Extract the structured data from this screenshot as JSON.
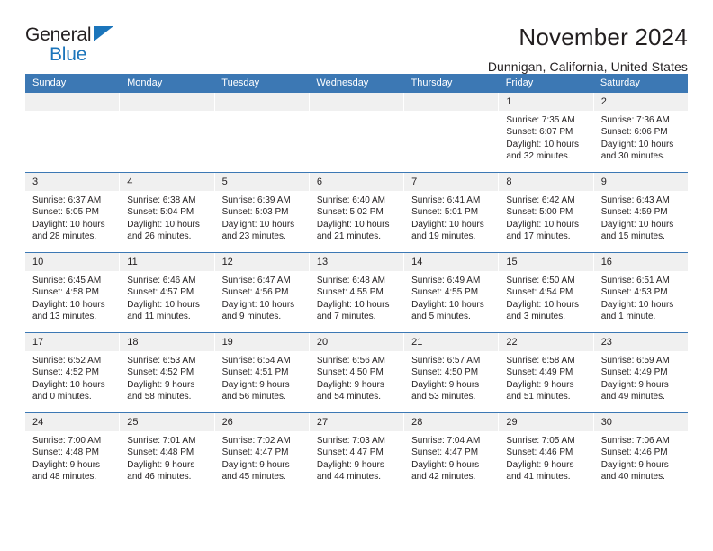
{
  "brand": {
    "line1": "General",
    "line2": "Blue",
    "triangle_color": "#1b75bb"
  },
  "header": {
    "title": "November 2024",
    "subtitle": "Dunnigan, California, United States"
  },
  "theme": {
    "header_blue": "#3c78b4",
    "day_band_gray": "#f0f0f0",
    "text": "#231f20"
  },
  "calendar": {
    "weekdays": [
      "Sunday",
      "Monday",
      "Tuesday",
      "Wednesday",
      "Thursday",
      "Friday",
      "Saturday"
    ],
    "weeks": [
      [
        {
          "day": "",
          "sunrise": "",
          "sunset": "",
          "daylight1": "",
          "daylight2": ""
        },
        {
          "day": "",
          "sunrise": "",
          "sunset": "",
          "daylight1": "",
          "daylight2": ""
        },
        {
          "day": "",
          "sunrise": "",
          "sunset": "",
          "daylight1": "",
          "daylight2": ""
        },
        {
          "day": "",
          "sunrise": "",
          "sunset": "",
          "daylight1": "",
          "daylight2": ""
        },
        {
          "day": "",
          "sunrise": "",
          "sunset": "",
          "daylight1": "",
          "daylight2": ""
        },
        {
          "day": "1",
          "sunrise": "Sunrise: 7:35 AM",
          "sunset": "Sunset: 6:07 PM",
          "daylight1": "Daylight: 10 hours",
          "daylight2": "and 32 minutes."
        },
        {
          "day": "2",
          "sunrise": "Sunrise: 7:36 AM",
          "sunset": "Sunset: 6:06 PM",
          "daylight1": "Daylight: 10 hours",
          "daylight2": "and 30 minutes."
        }
      ],
      [
        {
          "day": "3",
          "sunrise": "Sunrise: 6:37 AM",
          "sunset": "Sunset: 5:05 PM",
          "daylight1": "Daylight: 10 hours",
          "daylight2": "and 28 minutes."
        },
        {
          "day": "4",
          "sunrise": "Sunrise: 6:38 AM",
          "sunset": "Sunset: 5:04 PM",
          "daylight1": "Daylight: 10 hours",
          "daylight2": "and 26 minutes."
        },
        {
          "day": "5",
          "sunrise": "Sunrise: 6:39 AM",
          "sunset": "Sunset: 5:03 PM",
          "daylight1": "Daylight: 10 hours",
          "daylight2": "and 23 minutes."
        },
        {
          "day": "6",
          "sunrise": "Sunrise: 6:40 AM",
          "sunset": "Sunset: 5:02 PM",
          "daylight1": "Daylight: 10 hours",
          "daylight2": "and 21 minutes."
        },
        {
          "day": "7",
          "sunrise": "Sunrise: 6:41 AM",
          "sunset": "Sunset: 5:01 PM",
          "daylight1": "Daylight: 10 hours",
          "daylight2": "and 19 minutes."
        },
        {
          "day": "8",
          "sunrise": "Sunrise: 6:42 AM",
          "sunset": "Sunset: 5:00 PM",
          "daylight1": "Daylight: 10 hours",
          "daylight2": "and 17 minutes."
        },
        {
          "day": "9",
          "sunrise": "Sunrise: 6:43 AM",
          "sunset": "Sunset: 4:59 PM",
          "daylight1": "Daylight: 10 hours",
          "daylight2": "and 15 minutes."
        }
      ],
      [
        {
          "day": "10",
          "sunrise": "Sunrise: 6:45 AM",
          "sunset": "Sunset: 4:58 PM",
          "daylight1": "Daylight: 10 hours",
          "daylight2": "and 13 minutes."
        },
        {
          "day": "11",
          "sunrise": "Sunrise: 6:46 AM",
          "sunset": "Sunset: 4:57 PM",
          "daylight1": "Daylight: 10 hours",
          "daylight2": "and 11 minutes."
        },
        {
          "day": "12",
          "sunrise": "Sunrise: 6:47 AM",
          "sunset": "Sunset: 4:56 PM",
          "daylight1": "Daylight: 10 hours",
          "daylight2": "and 9 minutes."
        },
        {
          "day": "13",
          "sunrise": "Sunrise: 6:48 AM",
          "sunset": "Sunset: 4:55 PM",
          "daylight1": "Daylight: 10 hours",
          "daylight2": "and 7 minutes."
        },
        {
          "day": "14",
          "sunrise": "Sunrise: 6:49 AM",
          "sunset": "Sunset: 4:55 PM",
          "daylight1": "Daylight: 10 hours",
          "daylight2": "and 5 minutes."
        },
        {
          "day": "15",
          "sunrise": "Sunrise: 6:50 AM",
          "sunset": "Sunset: 4:54 PM",
          "daylight1": "Daylight: 10 hours",
          "daylight2": "and 3 minutes."
        },
        {
          "day": "16",
          "sunrise": "Sunrise: 6:51 AM",
          "sunset": "Sunset: 4:53 PM",
          "daylight1": "Daylight: 10 hours",
          "daylight2": "and 1 minute."
        }
      ],
      [
        {
          "day": "17",
          "sunrise": "Sunrise: 6:52 AM",
          "sunset": "Sunset: 4:52 PM",
          "daylight1": "Daylight: 10 hours",
          "daylight2": "and 0 minutes."
        },
        {
          "day": "18",
          "sunrise": "Sunrise: 6:53 AM",
          "sunset": "Sunset: 4:52 PM",
          "daylight1": "Daylight: 9 hours",
          "daylight2": "and 58 minutes."
        },
        {
          "day": "19",
          "sunrise": "Sunrise: 6:54 AM",
          "sunset": "Sunset: 4:51 PM",
          "daylight1": "Daylight: 9 hours",
          "daylight2": "and 56 minutes."
        },
        {
          "day": "20",
          "sunrise": "Sunrise: 6:56 AM",
          "sunset": "Sunset: 4:50 PM",
          "daylight1": "Daylight: 9 hours",
          "daylight2": "and 54 minutes."
        },
        {
          "day": "21",
          "sunrise": "Sunrise: 6:57 AM",
          "sunset": "Sunset: 4:50 PM",
          "daylight1": "Daylight: 9 hours",
          "daylight2": "and 53 minutes."
        },
        {
          "day": "22",
          "sunrise": "Sunrise: 6:58 AM",
          "sunset": "Sunset: 4:49 PM",
          "daylight1": "Daylight: 9 hours",
          "daylight2": "and 51 minutes."
        },
        {
          "day": "23",
          "sunrise": "Sunrise: 6:59 AM",
          "sunset": "Sunset: 4:49 PM",
          "daylight1": "Daylight: 9 hours",
          "daylight2": "and 49 minutes."
        }
      ],
      [
        {
          "day": "24",
          "sunrise": "Sunrise: 7:00 AM",
          "sunset": "Sunset: 4:48 PM",
          "daylight1": "Daylight: 9 hours",
          "daylight2": "and 48 minutes."
        },
        {
          "day": "25",
          "sunrise": "Sunrise: 7:01 AM",
          "sunset": "Sunset: 4:48 PM",
          "daylight1": "Daylight: 9 hours",
          "daylight2": "and 46 minutes."
        },
        {
          "day": "26",
          "sunrise": "Sunrise: 7:02 AM",
          "sunset": "Sunset: 4:47 PM",
          "daylight1": "Daylight: 9 hours",
          "daylight2": "and 45 minutes."
        },
        {
          "day": "27",
          "sunrise": "Sunrise: 7:03 AM",
          "sunset": "Sunset: 4:47 PM",
          "daylight1": "Daylight: 9 hours",
          "daylight2": "and 44 minutes."
        },
        {
          "day": "28",
          "sunrise": "Sunrise: 7:04 AM",
          "sunset": "Sunset: 4:47 PM",
          "daylight1": "Daylight: 9 hours",
          "daylight2": "and 42 minutes."
        },
        {
          "day": "29",
          "sunrise": "Sunrise: 7:05 AM",
          "sunset": "Sunset: 4:46 PM",
          "daylight1": "Daylight: 9 hours",
          "daylight2": "and 41 minutes."
        },
        {
          "day": "30",
          "sunrise": "Sunrise: 7:06 AM",
          "sunset": "Sunset: 4:46 PM",
          "daylight1": "Daylight: 9 hours",
          "daylight2": "and 40 minutes."
        }
      ]
    ]
  }
}
